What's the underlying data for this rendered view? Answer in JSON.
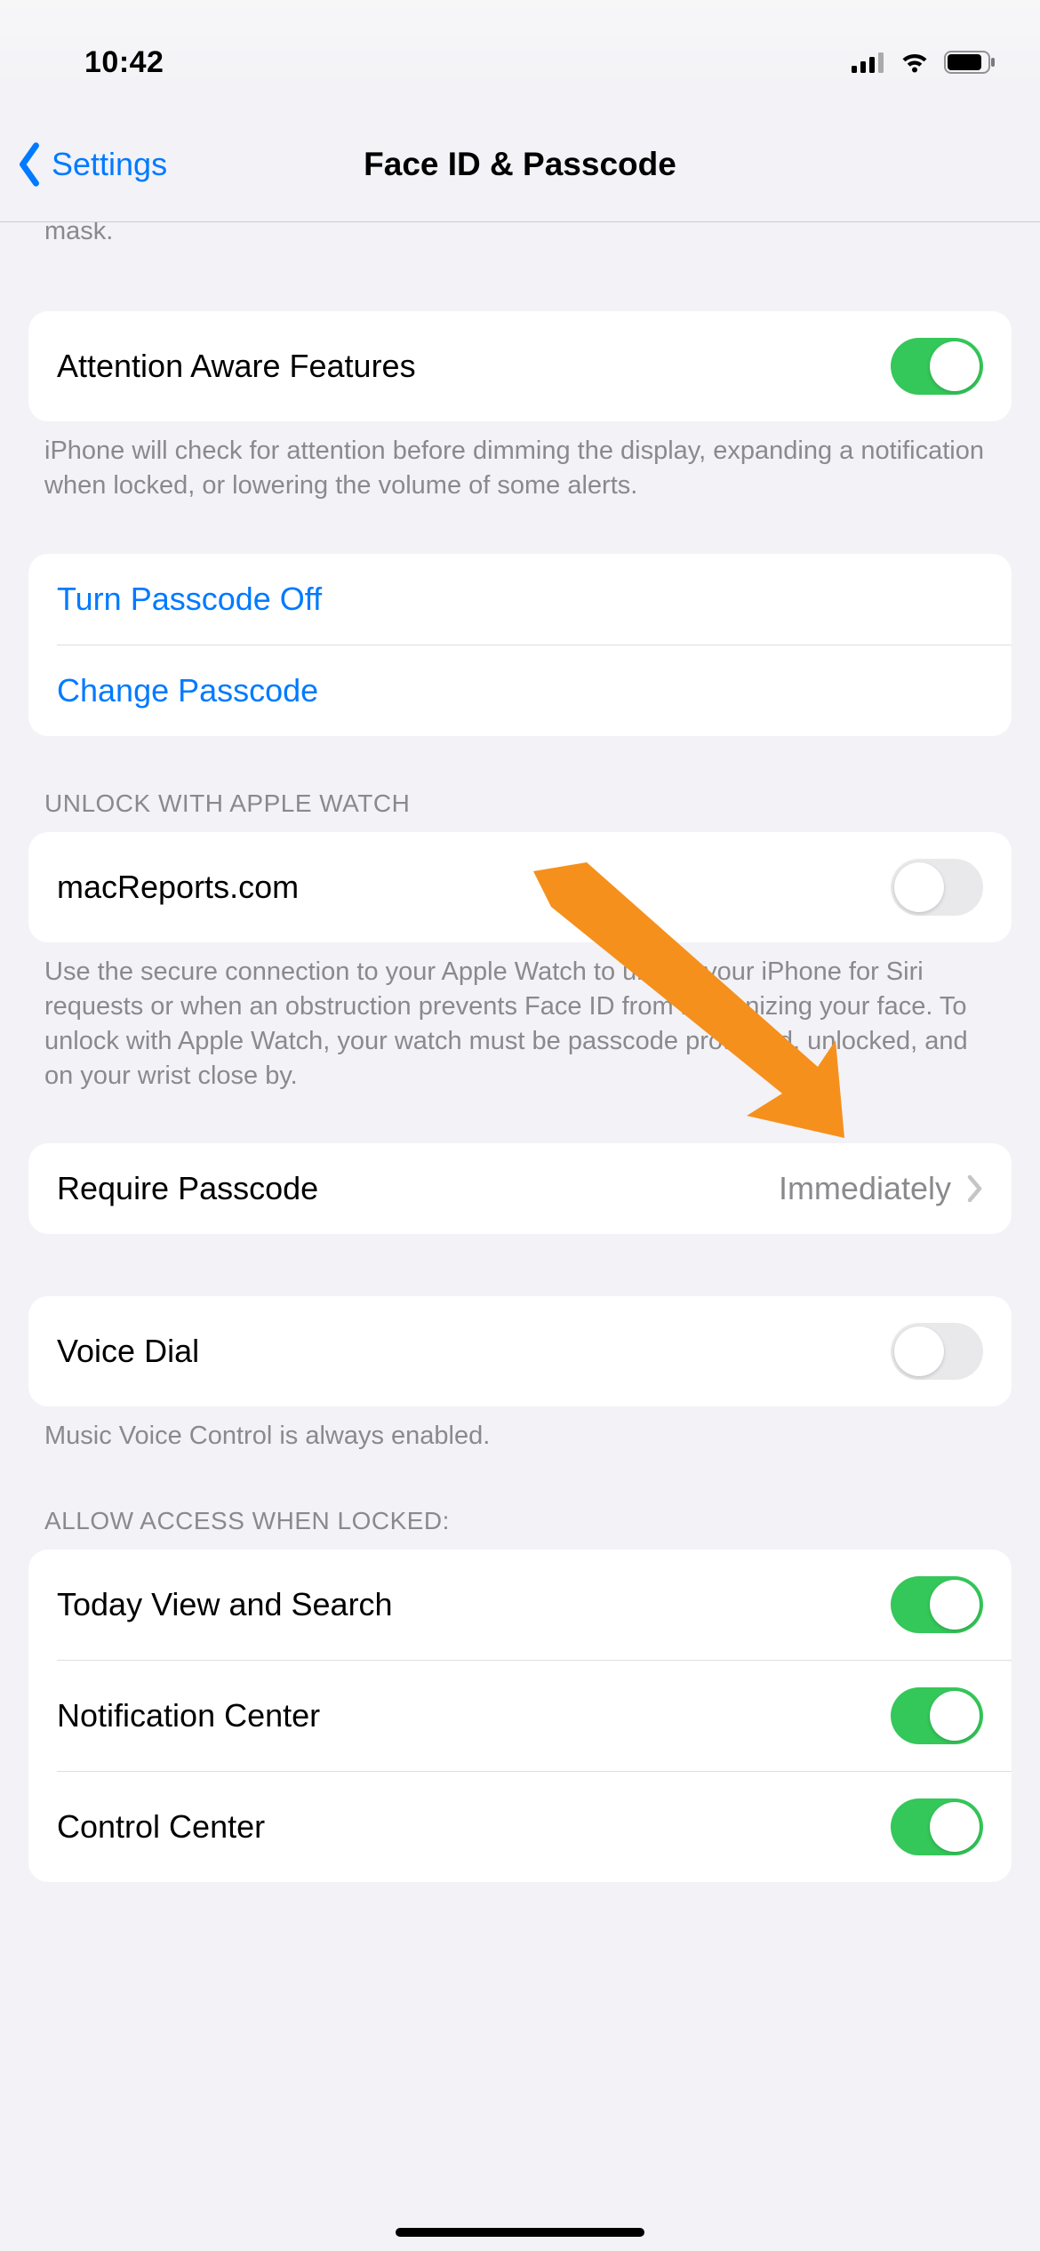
{
  "status": {
    "time": "10:42"
  },
  "nav": {
    "back_label": "Settings",
    "title": "Face ID & Passcode"
  },
  "fragment_top": "some sunglasses. Face ID will always require attention when you're wearing a mask.",
  "sections": {
    "attention": {
      "label": "Attention Aware Features",
      "on": true,
      "footer": "iPhone will check for attention before dimming the display, expanding a notification when locked, or lowering the volume of some alerts."
    },
    "passcode_actions": {
      "turn_off": "Turn Passcode Off",
      "change": "Change Passcode"
    },
    "watch": {
      "header": "UNLOCK WITH APPLE WATCH",
      "item_label": "macReports.com",
      "on": false,
      "footer": "Use the secure connection to your Apple Watch to unlock your iPhone for Siri requests or when an obstruction prevents Face ID from recognizing your face. To unlock with Apple Watch, your watch must be passcode protected, unlocked, and on your wrist close by."
    },
    "require": {
      "label": "Require Passcode",
      "value": "Immediately"
    },
    "voice": {
      "label": "Voice Dial",
      "on": false,
      "footer": "Music Voice Control is always enabled."
    },
    "allow": {
      "header": "ALLOW ACCESS WHEN LOCKED:",
      "items": [
        {
          "label": "Today View and Search",
          "on": true
        },
        {
          "label": "Notification Center",
          "on": true
        },
        {
          "label": "Control Center",
          "on": true
        }
      ]
    }
  }
}
